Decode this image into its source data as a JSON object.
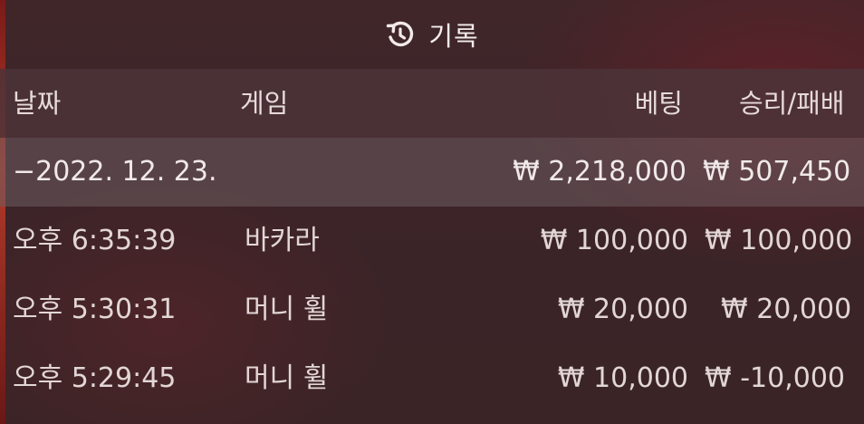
{
  "header": {
    "icon": "history-icon",
    "title": "기록"
  },
  "columns": {
    "date": "날짜",
    "game": "게임",
    "bet": "베팅",
    "result": "승리/패배"
  },
  "summary": {
    "date": "−2022. 12. 23.",
    "bet": "₩ 2,218,000",
    "result": "₩ 507,450"
  },
  "rows": [
    {
      "time": "오후 6:35:39",
      "game": "바카라",
      "bet": "₩ 100,000",
      "result": "₩ 100,000"
    },
    {
      "time": "오후 5:30:31",
      "game": "머니 휠",
      "bet": "₩ 20,000",
      "result": "₩ 20,000"
    },
    {
      "time": "오후 5:29:45",
      "game": "머니 휠",
      "bet": "₩ 10,000",
      "result": "₩ -10,000"
    }
  ],
  "colors": {
    "background": "#3c2428",
    "header_row": "#4c3438",
    "summary_row": "#6e5c60",
    "text": "#e9dede"
  }
}
